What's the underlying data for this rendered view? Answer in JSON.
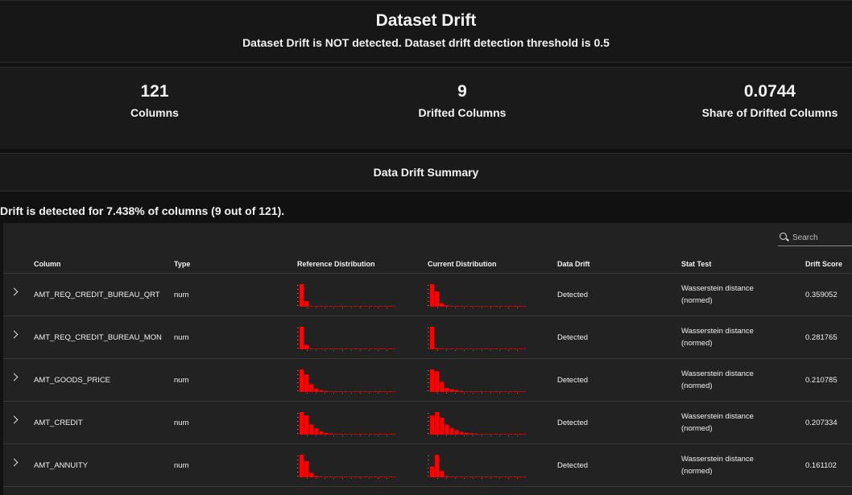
{
  "header": {
    "title": "Dataset Drift",
    "subtitle": "Dataset Drift is NOT detected. Dataset drift detection threshold is 0.5"
  },
  "counters": [
    {
      "value": "121",
      "label": "Columns"
    },
    {
      "value": "9",
      "label": "Drifted Columns"
    },
    {
      "value": "0.0744",
      "label": "Share of Drifted Columns"
    }
  ],
  "summary": {
    "heading": "Data Drift Summary",
    "detection_text": "Drift is detected for 7.438% of columns (9 out of 121)."
  },
  "search": {
    "placeholder": "Search",
    "icon": "search-icon"
  },
  "table": {
    "columns": [
      "Column",
      "Type",
      "Reference Distribution",
      "Current Distribution",
      "Data Drift",
      "Stat Test",
      "Drift Score"
    ],
    "bar_color": "#ff0000",
    "rows": [
      {
        "column": "AMT_REQ_CREDIT_BUREAU_QRT",
        "type": "num",
        "drift": "Detected",
        "stat_test_1": "Wasserstein distance",
        "stat_test_2": "(normed)",
        "score": "0.359052",
        "ref_hist": [
          1.0,
          0.25,
          0.03,
          0.01,
          0.01,
          0.005,
          0.005,
          0.005,
          0.005,
          0.005,
          0.005,
          0.005,
          0.005,
          0.005,
          0.005,
          0.005,
          0.005,
          0.005,
          0.005,
          0.005
        ],
        "cur_hist": [
          1.0,
          0.68,
          0.15,
          0.06,
          0.03,
          0.01,
          0.01,
          0.005,
          0.005,
          0.005,
          0.005,
          0.005,
          0.005,
          0.005,
          0.005,
          0.005,
          0.005,
          0.005,
          0.005,
          0.005
        ]
      },
      {
        "column": "AMT_REQ_CREDIT_BUREAU_MON",
        "type": "num",
        "drift": "Detected",
        "stat_test_1": "Wasserstein distance",
        "stat_test_2": "(normed)",
        "score": "0.281765",
        "ref_hist": [
          1.0,
          0.2,
          0.03,
          0.01,
          0.005,
          0.005,
          0.005,
          0.005,
          0.005,
          0.005,
          0.005,
          0.005,
          0.005,
          0.005,
          0.005,
          0.005,
          0.005,
          0.005,
          0.005,
          0.005
        ],
        "cur_hist": [
          1.0,
          0.05,
          0.02,
          0.01,
          0.005,
          0.005,
          0.005,
          0.005,
          0.005,
          0.005,
          0.005,
          0.005,
          0.005,
          0.005,
          0.005,
          0.005,
          0.005,
          0.005,
          0.005,
          0.005
        ]
      },
      {
        "column": "AMT_GOODS_PRICE",
        "type": "num",
        "drift": "Detected",
        "stat_test_1": "Wasserstein distance",
        "stat_test_2": "(normed)",
        "score": "0.210785",
        "ref_hist": [
          1.0,
          0.78,
          0.35,
          0.15,
          0.08,
          0.05,
          0.03,
          0.02,
          0.01,
          0.01,
          0.005,
          0.005,
          0.005,
          0.005,
          0.005,
          0.005,
          0.005,
          0.005,
          0.005,
          0.005
        ],
        "cur_hist": [
          1.0,
          0.92,
          0.45,
          0.18,
          0.12,
          0.08,
          0.05,
          0.03,
          0.02,
          0.01,
          0.01,
          0.005,
          0.005,
          0.005,
          0.005,
          0.005,
          0.005,
          0.005,
          0.005,
          0.005
        ]
      },
      {
        "column": "AMT_CREDIT",
        "type": "num",
        "drift": "Detected",
        "stat_test_1": "Wasserstein distance",
        "stat_test_2": "(normed)",
        "score": "0.207334",
        "ref_hist": [
          1.0,
          0.85,
          0.45,
          0.28,
          0.15,
          0.08,
          0.05,
          0.03,
          0.02,
          0.01,
          0.01,
          0.005,
          0.005,
          0.005,
          0.005,
          0.005,
          0.005,
          0.005,
          0.005,
          0.005
        ],
        "cur_hist": [
          0.85,
          1.0,
          0.75,
          0.45,
          0.3,
          0.2,
          0.12,
          0.08,
          0.06,
          0.04,
          0.03,
          0.02,
          0.01,
          0.01,
          0.005,
          0.005,
          0.005,
          0.005,
          0.005,
          0.005
        ]
      },
      {
        "column": "AMT_ANNUITY",
        "type": "num",
        "drift": "Detected",
        "stat_test_1": "Wasserstein distance",
        "stat_test_2": "(normed)",
        "score": "0.161102",
        "ref_hist": [
          1.0,
          0.72,
          0.2,
          0.06,
          0.02,
          0.01,
          0.005,
          0.005,
          0.005,
          0.005,
          0.005,
          0.005,
          0.005,
          0.005,
          0.005,
          0.005,
          0.005,
          0.005,
          0.005,
          0.005
        ],
        "cur_hist": [
          0.48,
          1.0,
          0.28,
          0.05,
          0.02,
          0.01,
          0.005,
          0.005,
          0.005,
          0.005,
          0.005,
          0.005,
          0.005,
          0.005,
          0.005,
          0.005,
          0.005,
          0.005,
          0.005,
          0.005
        ]
      }
    ]
  }
}
